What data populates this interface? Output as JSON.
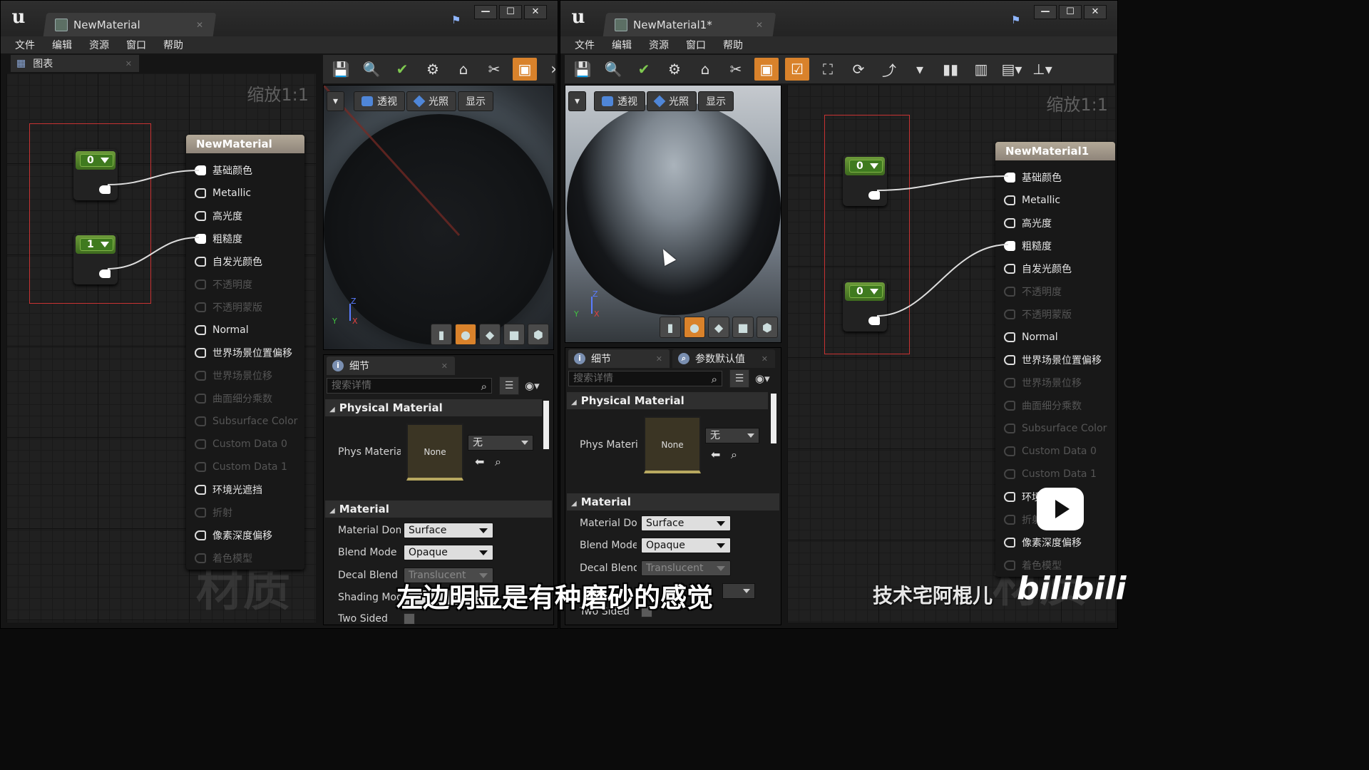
{
  "menu": [
    "文件",
    "编辑",
    "资源",
    "窗口",
    "帮助"
  ],
  "left": {
    "doc_title": "NewMaterial",
    "graph_tab": "图表",
    "zoom": "缩放1:1",
    "watermark": "材质",
    "constants": [
      "0",
      "1"
    ],
    "material_node": {
      "title": "NewMaterial",
      "pins": [
        {
          "label": "基础颜色",
          "state": "connected"
        },
        {
          "label": "Metallic",
          "state": "enabled"
        },
        {
          "label": "高光度",
          "state": "enabled"
        },
        {
          "label": "粗糙度",
          "state": "connected"
        },
        {
          "label": "自发光颜色",
          "state": "enabled"
        },
        {
          "label": "不透明度",
          "state": "disabled"
        },
        {
          "label": "不透明蒙版",
          "state": "disabled"
        },
        {
          "label": "Normal",
          "state": "enabled"
        },
        {
          "label": "世界场景位置偏移",
          "state": "enabled"
        },
        {
          "label": "世界场景位移",
          "state": "disabled"
        },
        {
          "label": "曲面细分乘数",
          "state": "disabled"
        },
        {
          "label": "Subsurface Color",
          "state": "disabled"
        },
        {
          "label": "Custom Data 0",
          "state": "disabled"
        },
        {
          "label": "Custom Data 1",
          "state": "disabled"
        },
        {
          "label": "环境光遮挡",
          "state": "enabled"
        },
        {
          "label": "折射",
          "state": "disabled"
        },
        {
          "label": "像素深度偏移",
          "state": "enabled"
        },
        {
          "label": "着色模型",
          "state": "disabled"
        }
      ]
    },
    "details": {
      "tab": "细节",
      "search_placeholder": "搜索详情",
      "cat_physical": "Physical Material",
      "phys_label": "Phys Material",
      "phys_thumb": "None",
      "phys_value": "无",
      "cat_material": "Material",
      "rows": [
        {
          "label": "Material Dom",
          "value": "Surface",
          "enabled": true
        },
        {
          "label": "Blend Mode",
          "value": "Opaque",
          "enabled": true
        },
        {
          "label": "Decal Blend M",
          "value": "Translucent",
          "enabled": false
        },
        {
          "label": "Shading Mode",
          "value": "",
          "enabled": true
        }
      ],
      "two_sided": "Two Sided"
    },
    "viewport_buttons": [
      "透视",
      "光照",
      "显示"
    ]
  },
  "right": {
    "doc_title": "NewMaterial1*",
    "zoom": "缩放1:1",
    "watermark": "材质",
    "constants": [
      "0",
      "0"
    ],
    "material_node": {
      "title": "NewMaterial1",
      "pins": [
        {
          "label": "基础颜色",
          "state": "connected"
        },
        {
          "label": "Metallic",
          "state": "enabled"
        },
        {
          "label": "高光度",
          "state": "enabled"
        },
        {
          "label": "粗糙度",
          "state": "connected"
        },
        {
          "label": "自发光颜色",
          "state": "enabled"
        },
        {
          "label": "不透明度",
          "state": "disabled"
        },
        {
          "label": "不透明蒙版",
          "state": "disabled"
        },
        {
          "label": "Normal",
          "state": "enabled"
        },
        {
          "label": "世界场景位置偏移",
          "state": "enabled"
        },
        {
          "label": "世界场景位移",
          "state": "disabled"
        },
        {
          "label": "曲面细分乘数",
          "state": "disabled"
        },
        {
          "label": "Subsurface Color",
          "state": "disabled"
        },
        {
          "label": "Custom Data 0",
          "state": "disabled"
        },
        {
          "label": "Custom Data 1",
          "state": "disabled"
        },
        {
          "label": "环境光遮挡",
          "state": "enabled"
        },
        {
          "label": "折射",
          "state": "disabled"
        },
        {
          "label": "像素深度偏移",
          "state": "enabled"
        },
        {
          "label": "着色模型",
          "state": "disabled"
        }
      ]
    },
    "details": {
      "tab": "细节",
      "tab2": "参数默认值",
      "search_placeholder": "搜索详情",
      "cat_physical": "Physical Material",
      "phys_label": "Phys Materi",
      "phys_thumb": "None",
      "phys_value": "无",
      "cat_material": "Material",
      "rows": [
        {
          "label": "Material Dom",
          "value": "Surface",
          "enabled": true
        },
        {
          "label": "Blend Mode",
          "value": "Opaque",
          "enabled": true
        },
        {
          "label": "Decal Blend",
          "value": "Translucent",
          "enabled": false
        }
      ],
      "two_sided": "Two Sided"
    },
    "viewport_buttons": [
      "透视",
      "光照",
      "显示"
    ]
  },
  "overlay": {
    "subtitle": "左边明显是有种磨砂的感觉",
    "author": "技术宅阿棍儿",
    "site_logo": "bilibili"
  },
  "colors": {
    "accent_orange": "#d9822b",
    "constant_green": "#3f7a1f",
    "selection_red": "#c83232",
    "node_header": "#a89e8f"
  }
}
